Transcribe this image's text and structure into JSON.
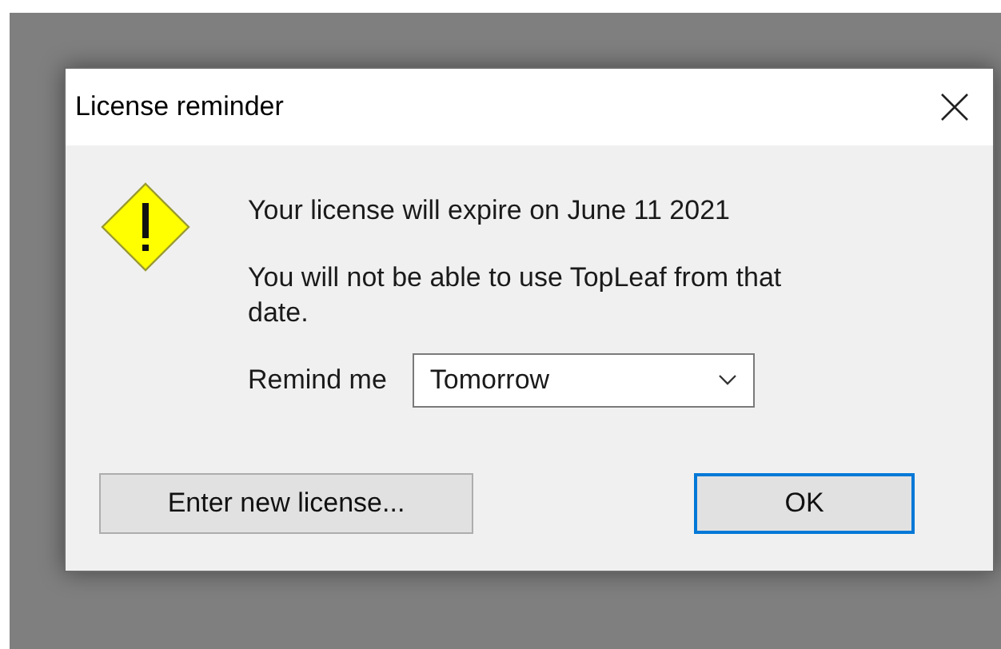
{
  "window": {
    "title": "License reminder"
  },
  "message": {
    "lines": [
      "Your license will expire on June 11 2021",
      "You will not be able to use TopLeaf from that date."
    ]
  },
  "remind": {
    "label": "Remind me",
    "value": "Tomorrow"
  },
  "buttons": [
    {
      "label": "Enter new license...",
      "default": false
    },
    {
      "label": "OK",
      "default": true
    }
  ]
}
